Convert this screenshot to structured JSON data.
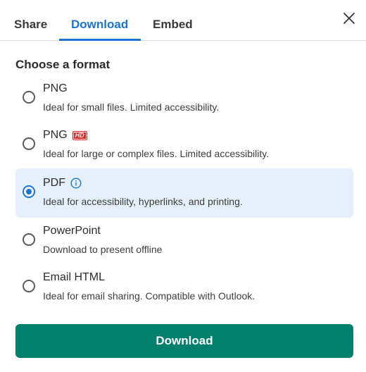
{
  "tabs": {
    "share": "Share",
    "download": "Download",
    "embed": "Embed",
    "active": "download"
  },
  "section_title": "Choose a format",
  "options": [
    {
      "title": "PNG",
      "desc": "Ideal for small files. Limited accessibility.",
      "selected": false
    },
    {
      "title": "PNG",
      "badge": "HD",
      "desc": "Ideal for large or complex files. Limited accessibility.",
      "selected": false
    },
    {
      "title": "PDF",
      "icon": "info-icon",
      "desc": "Ideal for accessibility, hyperlinks, and printing.",
      "selected": true
    },
    {
      "title": "PowerPoint",
      "desc": "Download to present offline",
      "selected": false
    },
    {
      "title": "Email HTML",
      "desc": "Ideal for email sharing. Compatible with Outlook.",
      "selected": false
    }
  ],
  "download_button": "Download",
  "colors": {
    "accent": "#1a73d9",
    "selected_bg": "#e6f0fc",
    "button": "#00806d",
    "hd_badge": "#e02424"
  }
}
